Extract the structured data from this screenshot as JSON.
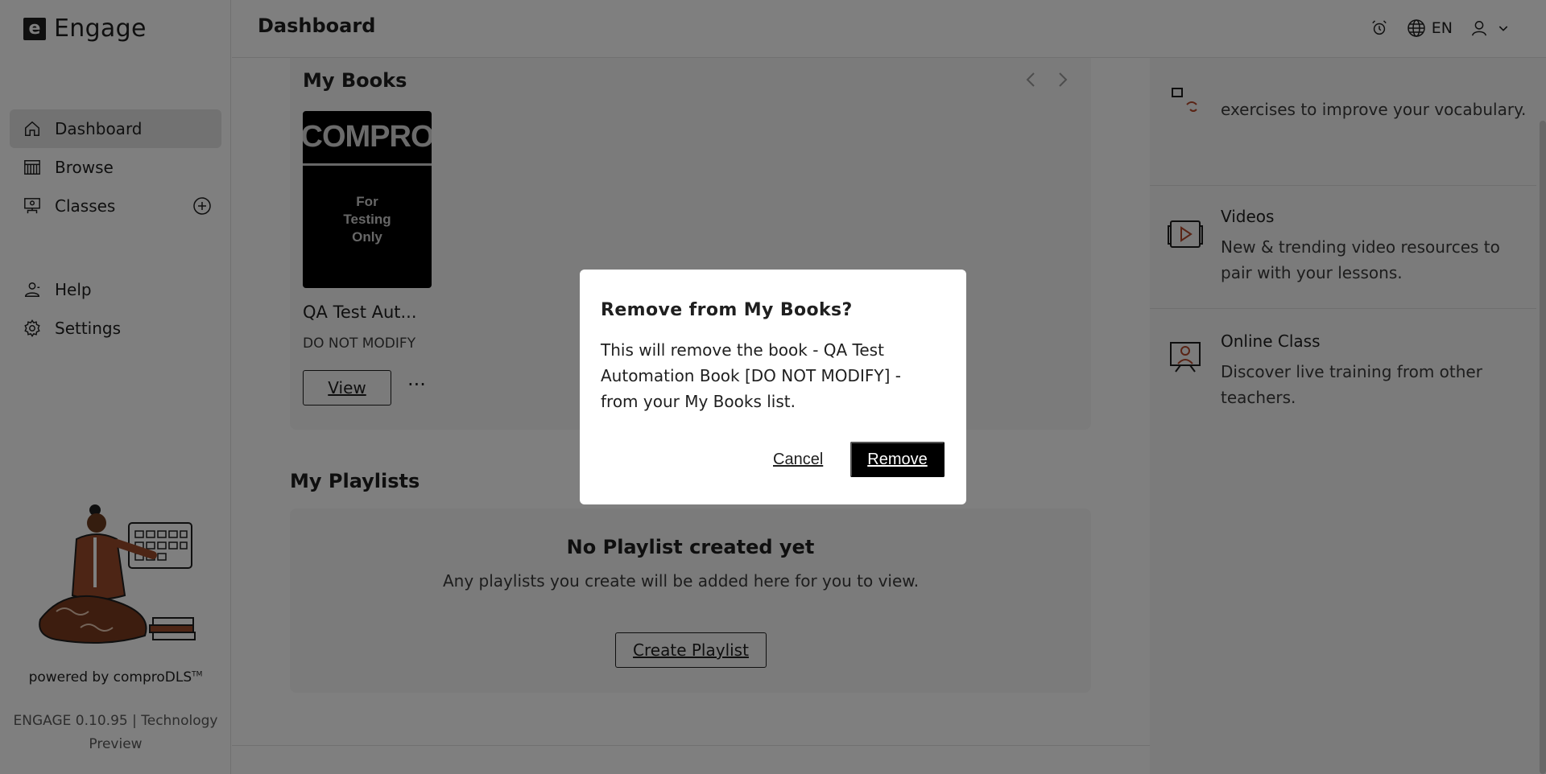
{
  "brand": {
    "mark": "e",
    "name": "Engage"
  },
  "sidebar": {
    "items": [
      {
        "label": "Dashboard",
        "icon": "home-icon",
        "active": true
      },
      {
        "label": "Browse",
        "icon": "library-icon"
      },
      {
        "label": "Classes",
        "icon": "classroom-icon",
        "action_icon": "add-circle-icon"
      },
      {
        "label": "Help",
        "icon": "help-icon"
      },
      {
        "label": "Settings",
        "icon": "gear-icon"
      }
    ],
    "powered_by": "powered by comproDLS",
    "powered_tm": "TM",
    "version": "ENGAGE 0.10.95 | Technology Preview"
  },
  "header": {
    "title": "Dashboard",
    "language": "EN",
    "icons": [
      "alarm-icon",
      "globe-icon",
      "user-icon",
      "chevron-down-icon"
    ]
  },
  "my_books": {
    "title": "My Books",
    "book": {
      "cover_top": "COMPRO",
      "cover_body": "For\nTesting\nOnly",
      "title": "QA Test Aut...",
      "subtitle": "DO NOT MODIFY",
      "view_label": "View",
      "more_label": "···"
    }
  },
  "my_playlists": {
    "title": "My Playlists",
    "empty_title": "No Playlist created yet",
    "empty_text": "Any playlists you create will be added here for you to view.",
    "create_label": "Create Playlist"
  },
  "right_panel": {
    "items": [
      {
        "title": "",
        "desc": "exercises to improve your vocabulary.",
        "icon": "vocabulary-icon"
      },
      {
        "title": "Videos",
        "desc": "New & trending video resources to pair with your lessons.",
        "icon": "video-icon"
      },
      {
        "title": "Online Class",
        "desc": "Discover live training from other teachers.",
        "icon": "online-class-icon"
      }
    ]
  },
  "modal": {
    "title": "Remove from My Books?",
    "body": "This will remove the book - QA Test Automation Book [DO NOT MODIFY] - from your My Books list.",
    "cancel_label": "Cancel",
    "remove_label": "Remove"
  },
  "colors": {
    "accent": "#1f1f1f",
    "icon_accent": "#b5482a",
    "overlay": "rgba(0,0,0,0.5)",
    "card_bg": "#f6f6f6"
  }
}
